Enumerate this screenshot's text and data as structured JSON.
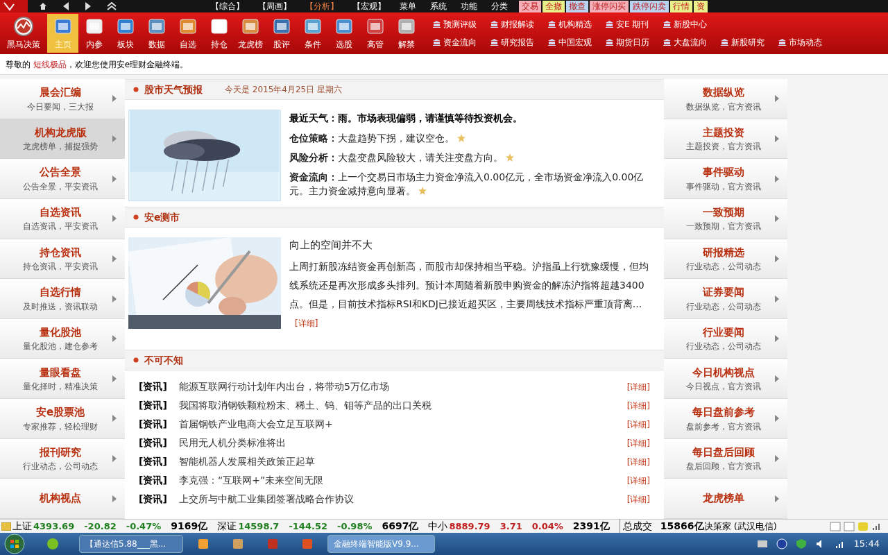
{
  "top_menu": {
    "tabs": [
      {
        "label": "【综合】",
        "selected": false
      },
      {
        "label": "【周画】",
        "selected": false
      },
      {
        "label": "【分析】",
        "selected": true
      },
      {
        "label": "【宏观】",
        "selected": false
      }
    ],
    "menus": [
      "菜单",
      "系统",
      "功能",
      "分类"
    ],
    "quick_buttons": [
      {
        "label": "交易",
        "color": "#f4b0b8"
      },
      {
        "label": "全撤",
        "color": "#e8f08a"
      },
      {
        "label": "撤查",
        "color": "#b8d4f0"
      },
      {
        "label": "涨停闪买",
        "color": "#f4b0b8"
      },
      {
        "label": "跌停闪卖",
        "color": "#b8d4f0"
      },
      {
        "label": "行情",
        "color": "#e8f08a"
      },
      {
        "label": "资",
        "color": "#e8f08a"
      }
    ]
  },
  "toolbar": [
    {
      "label": "黑马决策",
      "selected": false
    },
    {
      "label": "主页",
      "selected": true
    },
    {
      "label": "内参",
      "selected": false
    },
    {
      "label": "板块",
      "selected": false
    },
    {
      "label": "数据",
      "selected": false
    },
    {
      "label": "自选",
      "selected": false
    },
    {
      "label": "持仓",
      "selected": false
    },
    {
      "label": "龙虎榜",
      "selected": false
    },
    {
      "label": "股评",
      "selected": false
    },
    {
      "label": "条件",
      "selected": false
    },
    {
      "label": "选股",
      "selected": false
    },
    {
      "label": "高管",
      "selected": false
    },
    {
      "label": "解禁",
      "selected": false
    }
  ],
  "quick_links": [
    [
      "预测评级",
      "财报解读",
      "机构精选",
      "安E 期刊",
      "新股中心"
    ],
    [
      "资金流向",
      "研究报告",
      "中国宏观",
      "期货日历",
      "大盘流向",
      "新股研究",
      "市场动态"
    ]
  ],
  "welcome": {
    "prefix": "尊敬的",
    "user": "短线极品",
    "suffix": "，欢迎您使用安e理财金融终端。"
  },
  "left_sidebar": [
    {
      "title": "晨会汇编",
      "subtitle": "今日要闻，三大报",
      "selected": false
    },
    {
      "title": "机构龙虎版",
      "subtitle": "龙虎榜单，捕捉强势",
      "selected": true
    },
    {
      "title": "公告全景",
      "subtitle": "公告全景，平安资讯",
      "selected": false
    },
    {
      "title": "自选资讯",
      "subtitle": "自选资讯，平安资讯",
      "selected": false
    },
    {
      "title": "持仓资讯",
      "subtitle": "持仓资讯，平安资讯",
      "selected": false
    },
    {
      "title": "自选行情",
      "subtitle": "及时推送，资讯联动",
      "selected": false
    },
    {
      "title": "量化股池",
      "subtitle": "量化股池，建仓参考",
      "selected": false
    },
    {
      "title": "量眼看盘",
      "subtitle": "量化择时，精准决策",
      "selected": false
    },
    {
      "title": "安e股票池",
      "subtitle": "专家推荐，轻松理财",
      "selected": false
    },
    {
      "title": "报刊研究",
      "subtitle": "行业动态，公司动态",
      "selected": false
    },
    {
      "title": "机构视点",
      "selected": false
    }
  ],
  "right_sidebar": [
    {
      "title": "数据纵览",
      "subtitle": "数据纵览，官方资讯"
    },
    {
      "title": "主题投资",
      "subtitle": "主题投资，官方资讯"
    },
    {
      "title": "事件驱动",
      "subtitle": "事件驱动，官方资讯"
    },
    {
      "title": "一致预期",
      "subtitle": "一致预期，官方资讯"
    },
    {
      "title": "研报精选",
      "subtitle": "行业动态，公司动态"
    },
    {
      "title": "证券要闻",
      "subtitle": "行业动态，公司动态"
    },
    {
      "title": "行业要闻",
      "subtitle": "行业动态，公司动态"
    },
    {
      "title": "今日机构视点",
      "subtitle": "今日视点，官方资讯"
    },
    {
      "title": "每日盘前参考",
      "subtitle": "盘前参考，官方资讯"
    },
    {
      "title": "每日盘后回顾",
      "subtitle": "盘后回顾，官方资讯"
    },
    {
      "title": "龙虎榜单"
    }
  ],
  "weather": {
    "heading": "股市天气预报",
    "date": "今天是 2015年4月25日 星期六",
    "headline": "最近天气：雨。市场表现偏弱，请谨慎等待投资机会。",
    "items": [
      {
        "label": "仓位策略：",
        "text": "大盘趋势下拐，建议空仓。"
      },
      {
        "label": "风险分析：",
        "text": "大盘变盘风险较大，请关注变盘方向。"
      },
      {
        "label": "资金流向：",
        "text": "上一个交易日市场主力资金净流入0.00亿元，全市场资金净流入0.00亿元。主力资金减持意向显著。"
      }
    ]
  },
  "forecast": {
    "heading": "安e测市",
    "title": "向上的空间并不大",
    "body": "上周打新股冻结资金再创新高，而股市却保持相当平稳。沪指虽上行犹豫缓慢，但均线系统还是再次形成多头排列。预计本周随着新股申购资金的解冻沪指将超越3400点。但是，目前技术指标RSI和KDJ已接近超买区，主要周线技术指标严重顶背离...",
    "more": "[详细]"
  },
  "must_know": {
    "heading": "不可不知",
    "rows": [
      {
        "tag": "[资讯]",
        "title": "能源互联网行动计划年内出台，将带动5万亿市场",
        "more": "[详细]"
      },
      {
        "tag": "[资讯]",
        "title": "我国将取消钢铁颗粒粉末、稀土、钨、钼等产品的出口关税",
        "more": "[详细]"
      },
      {
        "tag": "[资讯]",
        "title": "首届钢铁产业电商大会立足互联网+",
        "more": "[详细]"
      },
      {
        "tag": "[资讯]",
        "title": "民用无人机分类标准将出",
        "more": "[详细]"
      },
      {
        "tag": "[资讯]",
        "title": "智能机器人发展相关政策正起草",
        "more": "[详细]"
      },
      {
        "tag": "[资讯]",
        "title": "李克强：“互联网+”未来空间无限",
        "more": "[详细]"
      },
      {
        "tag": "[资讯]",
        "title": "上交所与中航工业集团签署战略合作协议",
        "more": "[详细]"
      }
    ]
  },
  "status_bar": {
    "indices": [
      {
        "name": "上证",
        "value": "4393.69",
        "change": "-20.82",
        "percent": "-0.47%",
        "volume": "9169亿",
        "up": false
      },
      {
        "name": "深证",
        "value": "14598.7",
        "change": "-144.52",
        "percent": "-0.98%",
        "volume": "6697亿",
        "up": false
      },
      {
        "name": "中小",
        "value": "8889.79",
        "change": "3.71",
        "percent": "0.04%",
        "volume": "2391亿",
        "up": true
      }
    ],
    "total_label": "总成交",
    "total": "15866亿",
    "server": "决策家 (武汉电信)"
  },
  "taskbar": {
    "tasks": [
      {
        "label": "【通达信5.88___黑...",
        "selected": false
      },
      {
        "label": "金融终端智能版V9.9...",
        "selected": true
      }
    ],
    "clock": "15:44"
  }
}
